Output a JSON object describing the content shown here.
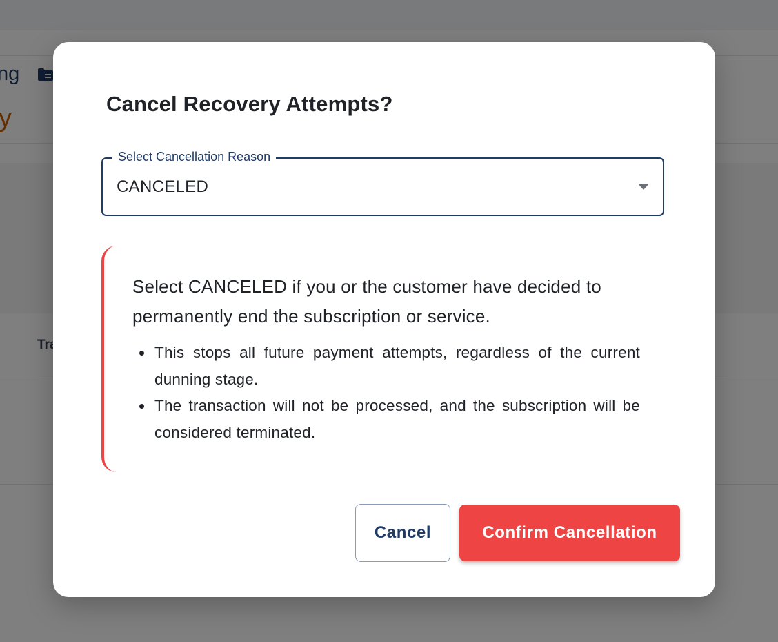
{
  "background": {
    "breadcrumb_tail": "ng",
    "title_tail": "y",
    "table_header_tail": "Tra"
  },
  "dialog": {
    "title": "Cancel Recovery Attempts?",
    "select": {
      "label": "Select Cancellation Reason",
      "value": "CANCELED"
    },
    "info": {
      "lead": "Select CANCELED if you or the customer have decided to permanently end the subscription or service.",
      "bullets": [
        "This stops all future payment attempts, regardless of the current dunning stage.",
        "The transaction will not be processed, and the subscription will be considered terminated."
      ],
      "accent_color": "#ef4444"
    },
    "buttons": {
      "cancel_label": "Cancel",
      "confirm_label": "Confirm Cancellation"
    }
  },
  "colors": {
    "primary": "#1f3b66",
    "danger": "#ef4444",
    "overlay": "rgba(0,0,0,0.5)"
  },
  "icons": {
    "folder": "folder-icon",
    "caret": "caret-down-icon"
  }
}
